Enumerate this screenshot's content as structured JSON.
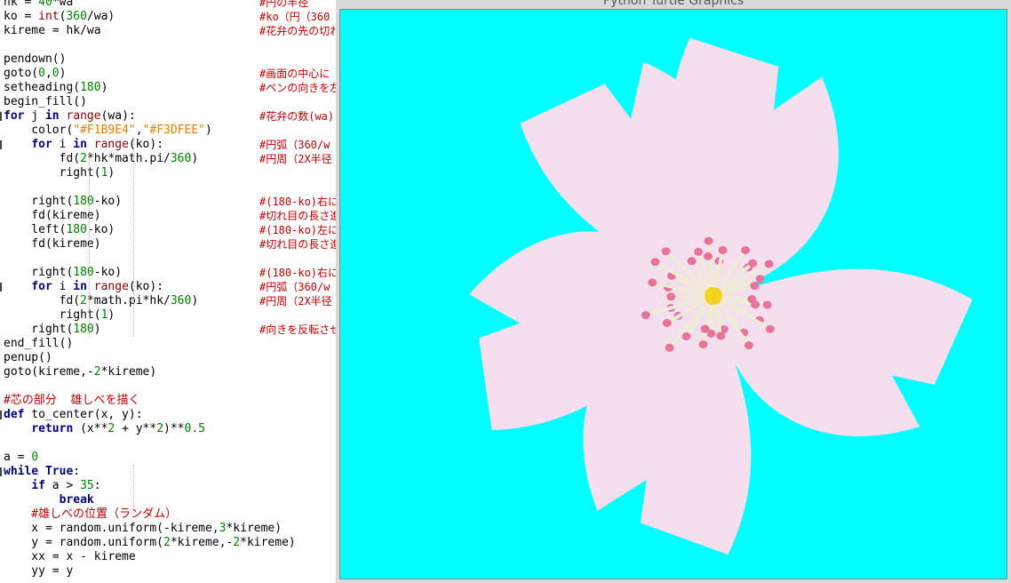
{
  "editor": {
    "lines": [
      {
        "code": "hk = 40*wa",
        "comment": "#円の半径"
      },
      {
        "code": "ko = int(360/wa)",
        "comment": "#ko（円（360"
      },
      {
        "code": "kireme = hk/wa",
        "comment": "#花弁の先の切れ"
      },
      {
        "code": "",
        "comment": ""
      },
      {
        "code": "pendown()",
        "comment": ""
      },
      {
        "code": "goto(0,0)",
        "comment": "#画面の中心に"
      },
      {
        "code": "setheading(180)",
        "comment": "#ペンの向きを左"
      },
      {
        "code": "begin_fill()",
        "comment": ""
      },
      {
        "code": "for j in range(wa):",
        "comment": "#花弁の数(wa)"
      },
      {
        "code": "    color(\"#F1B9E4\",\"#F3DFEE\")",
        "comment": ""
      },
      {
        "code": "    for i in range(ko):",
        "comment": "#円弧（360/w"
      },
      {
        "code": "        fd(2*hk*math.pi/360)",
        "comment": "#円周（2X半径"
      },
      {
        "code": "        right(1)",
        "comment": ""
      },
      {
        "code": "",
        "comment": ""
      },
      {
        "code": "    right(180-ko)",
        "comment": "#(180-ko)右に"
      },
      {
        "code": "    fd(kireme)",
        "comment": "#切れ目の長さ進"
      },
      {
        "code": "    left(180-ko)",
        "comment": "#(180-ko)左に"
      },
      {
        "code": "    fd(kireme)",
        "comment": "#切れ目の長さ進"
      },
      {
        "code": "",
        "comment": ""
      },
      {
        "code": "    right(180-ko)",
        "comment": "#(180-ko)右に"
      },
      {
        "code": "    for i in range(ko):",
        "comment": "#円弧（360/w"
      },
      {
        "code": "        fd(2*math.pi*hk/360)",
        "comment": "#円周（2X半径"
      },
      {
        "code": "        right(1)",
        "comment": ""
      },
      {
        "code": "    right(180)",
        "comment": "#向きを反転させ"
      },
      {
        "code": "end_fill()",
        "comment": ""
      },
      {
        "code": "penup()",
        "comment": ""
      },
      {
        "code": "goto(kireme,-2*kireme)",
        "comment": ""
      },
      {
        "code": "",
        "comment": ""
      },
      {
        "code": "#芯の部分  雄しべを描く",
        "comment": ""
      },
      {
        "code": "def to_center(x, y):",
        "comment": ""
      },
      {
        "code": "    return (x**2 + y**2)**0.5",
        "comment": ""
      },
      {
        "code": "",
        "comment": ""
      },
      {
        "code": "a = 0",
        "comment": ""
      },
      {
        "code": "while True:",
        "comment": ""
      },
      {
        "code": "    if a > 35:",
        "comment": ""
      },
      {
        "code": "        break",
        "comment": ""
      },
      {
        "code": "    #雄しべの位置（ランダム）",
        "comment": ""
      },
      {
        "code": "    x = random.uniform(-kireme,3*kireme)",
        "comment": ""
      },
      {
        "code": "    y = random.uniform(2*kireme,-2*kireme)",
        "comment": ""
      },
      {
        "code": "    xx = x - kireme",
        "comment": ""
      },
      {
        "code": "    yy = y",
        "comment": ""
      }
    ]
  },
  "turtle_window": {
    "title": "Python Turtle Graphics",
    "canvas_color": "#00FFFF",
    "petal_fill": "#F3DFEE",
    "stamen_color": "#F0EBD8",
    "anther_color": "#E8739A",
    "pistil_color": "#F2D21B",
    "petal_count": 5,
    "stamen_count": 36
  }
}
